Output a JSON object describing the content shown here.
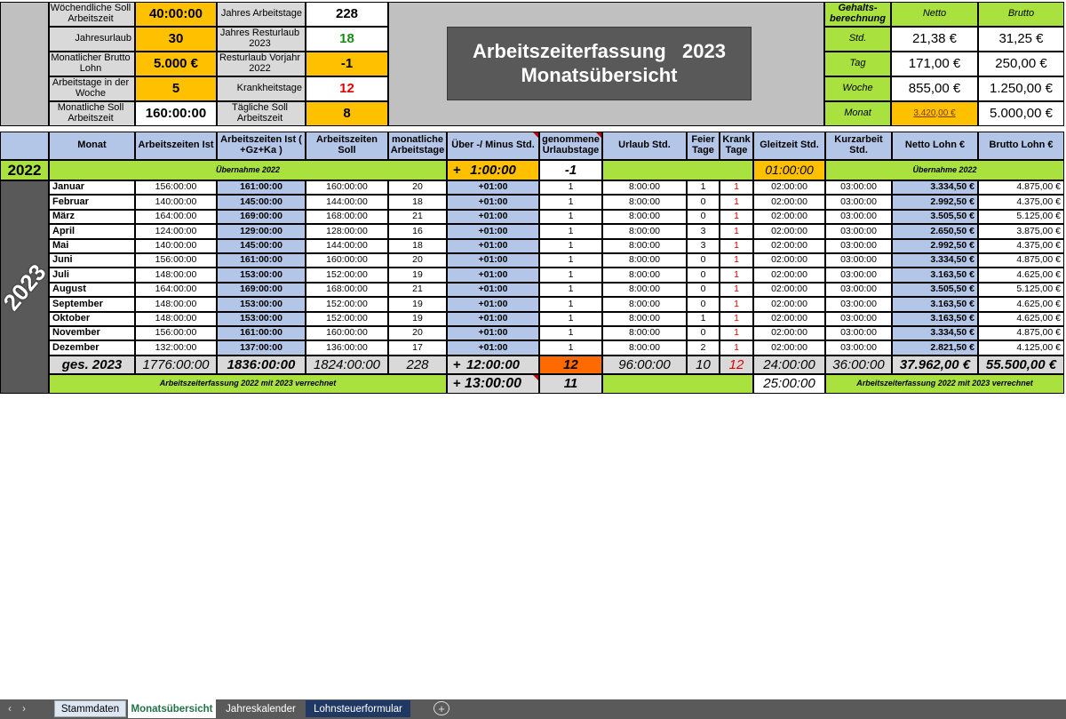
{
  "header": {
    "left": [
      {
        "label": "Wöchendliche Soll Arbeitszeit",
        "value": "40:00:00"
      },
      {
        "label": "Jahresurlaub",
        "value": "30"
      },
      {
        "label": "Monatlicher Brutto Lohn",
        "value": "5.000 €"
      },
      {
        "label": "Arbeitstage in der Woche",
        "value": "5"
      },
      {
        "label": "Monatliche Soll Arbeitszeit",
        "value": "160:00:00"
      }
    ],
    "mid": [
      {
        "label": "Jahres Arbeitstage",
        "value": "228"
      },
      {
        "label": "Jahres Resturlaub 2023",
        "value": "18"
      },
      {
        "label": "Resturlaub Vorjahr 2022",
        "value": "-1"
      },
      {
        "label": "Krankheitstage",
        "value": "12"
      },
      {
        "label": "Tägliche Soll Arbeitszeit",
        "value": "8"
      }
    ],
    "title_line1": "Arbeitszeiterfassung   2023",
    "title_line2": "Monatsübersicht",
    "salary": {
      "title": "Gehalts-berechnung",
      "col_netto": "Netto",
      "col_brutto": "Brutto",
      "rows": [
        {
          "label": "Std.",
          "netto": "21,38 €",
          "brutto": "31,25 €"
        },
        {
          "label": "Tag",
          "netto": "171,00 €",
          "brutto": "250,00 €"
        },
        {
          "label": "Woche",
          "netto": "855,00 €",
          "brutto": "1.250,00 €"
        },
        {
          "label": "Monat",
          "netto": "3.420,00 €",
          "brutto": "5.000,00 €"
        }
      ]
    }
  },
  "table": {
    "headers": [
      "Monat",
      "Arbeitszeiten Ist",
      "Arbeitszeiten Ist ( +Gz+Ka  )",
      "Arbeitszeiten Soll",
      "monatliche Arbeitstage",
      "Über -/ Minus Std.",
      "genommene Urlaubstage",
      "Urlaub Std.",
      "Feier Tage",
      "Krank Tage",
      "Gleitzeit Std.",
      "Kurzarbeit Std.",
      "Netto Lohn €",
      "Brutto Lohn €"
    ],
    "prev": {
      "year": "2022",
      "uebernahme_left": "Übernahme  2022",
      "plus": "+",
      "ueber": "1:00:00",
      "urlaub": "-1",
      "gleitzeit": "01:00:00",
      "uebernahme_right": "Übernahme  2022"
    },
    "year_label": "2023",
    "rows": [
      {
        "monat": "Januar",
        "ist": "156:00:00",
        "istgz": "161:00:00",
        "soll": "160:00:00",
        "tage": "20",
        "ueber": "+01:00",
        "urlaub": "1",
        "urlaub_std": "8:00:00",
        "feier": "1",
        "krank": "1",
        "gleit": "02:00:00",
        "kurz": "03:00:00",
        "netto": "3.334,50 €",
        "brutto": "4.875,00 €"
      },
      {
        "monat": "Februar",
        "ist": "140:00:00",
        "istgz": "145:00:00",
        "soll": "144:00:00",
        "tage": "18",
        "ueber": "+01:00",
        "urlaub": "1",
        "urlaub_std": "8:00:00",
        "feier": "0",
        "krank": "1",
        "gleit": "02:00:00",
        "kurz": "03:00:00",
        "netto": "2.992,50 €",
        "brutto": "4.375,00 €"
      },
      {
        "monat": "März",
        "ist": "164:00:00",
        "istgz": "169:00:00",
        "soll": "168:00:00",
        "tage": "21",
        "ueber": "+01:00",
        "urlaub": "1",
        "urlaub_std": "8:00:00",
        "feier": "0",
        "krank": "1",
        "gleit": "02:00:00",
        "kurz": "03:00:00",
        "netto": "3.505,50 €",
        "brutto": "5.125,00 €"
      },
      {
        "monat": "April",
        "ist": "124:00:00",
        "istgz": "129:00:00",
        "soll": "128:00:00",
        "tage": "16",
        "ueber": "+01:00",
        "urlaub": "1",
        "urlaub_std": "8:00:00",
        "feier": "3",
        "krank": "1",
        "gleit": "02:00:00",
        "kurz": "03:00:00",
        "netto": "2.650,50 €",
        "brutto": "3.875,00 €"
      },
      {
        "monat": "Mai",
        "ist": "140:00:00",
        "istgz": "145:00:00",
        "soll": "144:00:00",
        "tage": "18",
        "ueber": "+01:00",
        "urlaub": "1",
        "urlaub_std": "8:00:00",
        "feier": "3",
        "krank": "1",
        "gleit": "02:00:00",
        "kurz": "03:00:00",
        "netto": "2.992,50 €",
        "brutto": "4.375,00 €"
      },
      {
        "monat": "Juni",
        "ist": "156:00:00",
        "istgz": "161:00:00",
        "soll": "160:00:00",
        "tage": "20",
        "ueber": "+01:00",
        "urlaub": "1",
        "urlaub_std": "8:00:00",
        "feier": "0",
        "krank": "1",
        "gleit": "02:00:00",
        "kurz": "03:00:00",
        "netto": "3.334,50 €",
        "brutto": "4.875,00 €"
      },
      {
        "monat": "Juli",
        "ist": "148:00:00",
        "istgz": "153:00:00",
        "soll": "152:00:00",
        "tage": "19",
        "ueber": "+01:00",
        "urlaub": "1",
        "urlaub_std": "8:00:00",
        "feier": "0",
        "krank": "1",
        "gleit": "02:00:00",
        "kurz": "03:00:00",
        "netto": "3.163,50 €",
        "brutto": "4.625,00 €"
      },
      {
        "monat": "August",
        "ist": "164:00:00",
        "istgz": "169:00:00",
        "soll": "168:00:00",
        "tage": "21",
        "ueber": "+01:00",
        "urlaub": "1",
        "urlaub_std": "8:00:00",
        "feier": "0",
        "krank": "1",
        "gleit": "02:00:00",
        "kurz": "03:00:00",
        "netto": "3.505,50 €",
        "brutto": "5.125,00 €"
      },
      {
        "monat": "September",
        "ist": "148:00:00",
        "istgz": "153:00:00",
        "soll": "152:00:00",
        "tage": "19",
        "ueber": "+01:00",
        "urlaub": "1",
        "urlaub_std": "8:00:00",
        "feier": "0",
        "krank": "1",
        "gleit": "02:00:00",
        "kurz": "03:00:00",
        "netto": "3.163,50 €",
        "brutto": "4.625,00 €"
      },
      {
        "monat": "Oktober",
        "ist": "148:00:00",
        "istgz": "153:00:00",
        "soll": "152:00:00",
        "tage": "19",
        "ueber": "+01:00",
        "urlaub": "1",
        "urlaub_std": "8:00:00",
        "feier": "1",
        "krank": "1",
        "gleit": "02:00:00",
        "kurz": "03:00:00",
        "netto": "3.163,50 €",
        "brutto": "4.625,00 €"
      },
      {
        "monat": "November",
        "ist": "156:00:00",
        "istgz": "161:00:00",
        "soll": "160:00:00",
        "tage": "20",
        "ueber": "+01:00",
        "urlaub": "1",
        "urlaub_std": "8:00:00",
        "feier": "0",
        "krank": "1",
        "gleit": "02:00:00",
        "kurz": "03:00:00",
        "netto": "3.334,50 €",
        "brutto": "4.875,00 €"
      },
      {
        "monat": "Dezember",
        "ist": "132:00:00",
        "istgz": "137:00:00",
        "soll": "136:00:00",
        "tage": "17",
        "ueber": "+01:00",
        "urlaub": "1",
        "urlaub_std": "8:00:00",
        "feier": "2",
        "krank": "1",
        "gleit": "02:00:00",
        "kurz": "03:00:00",
        "netto": "2.821,50 €",
        "brutto": "4.125,00 €"
      }
    ],
    "total": {
      "label": "ges. 2023",
      "ist": "1776:00:00",
      "istgz": "1836:00:00",
      "soll": "1824:00:00",
      "tage": "228",
      "plus": "+",
      "ueber": "12:00:00",
      "urlaub": "12",
      "urlaub_std": "96:00:00",
      "feier": "10",
      "krank": "12",
      "gleit": "24:00:00",
      "kurz": "36:00:00",
      "netto": "37.962,00 €",
      "brutto": "55.500,00 €"
    },
    "footer": {
      "left_note": "Arbeitszeiterfassung 2022 mit 2023 verrechnet",
      "plus": "+",
      "ueber": "13:00:00",
      "urlaub": "11",
      "gleit": "25:00:00",
      "right_note": "Arbeitszeiterfassung 2022 mit 2023 verrechnet"
    }
  },
  "tabs": {
    "nav_prev": "‹",
    "nav_next": "›",
    "items": [
      "Stammdaten",
      "Monatsübersicht",
      "Jahreskalender",
      "Lohnsteuerformular"
    ],
    "add": "+"
  }
}
